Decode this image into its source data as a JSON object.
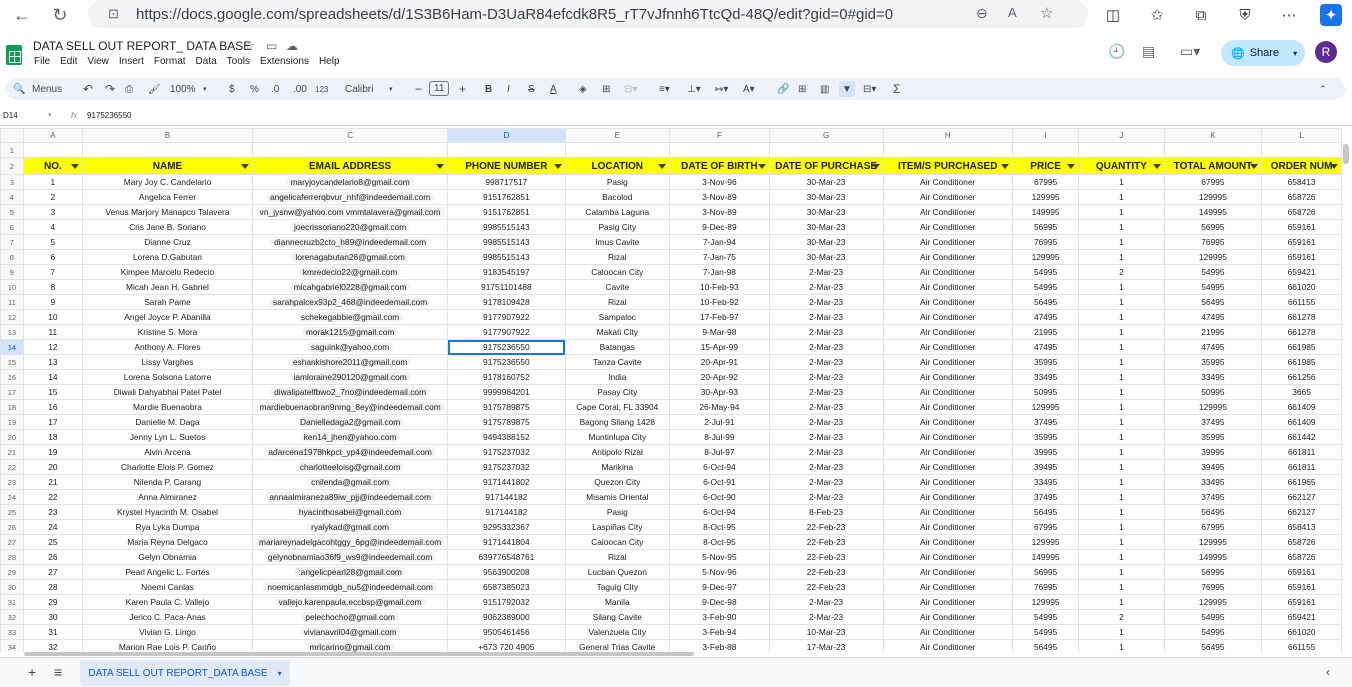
{
  "browser": {
    "url": "https://docs.google.com/spreadsheets/d/1S3B6Ham-D3UaR84efcdk8R5_rT7vJfnnh6TtcQd-48Q/edit?gid=0#gid=0",
    "zoom_glyph": "A͡"
  },
  "doc": {
    "title": "DATA SELL OUT REPORT_ DATA BASE",
    "menu": [
      "File",
      "Edit",
      "View",
      "Insert",
      "Format",
      "Data",
      "Tools",
      "Extensions",
      "Help"
    ],
    "share_label": "Share",
    "avatar_letter": "R"
  },
  "toolbar": {
    "menus_label": "Menus",
    "zoom": "100%",
    "currency": "$",
    "percent": "%",
    "dec_decrease": ".0",
    "dec_increase": ".00",
    "number_format": "123",
    "font": "Calibri",
    "font_size": "11",
    "bold": "B",
    "italic": "I",
    "strike": "S",
    "text_color": "A",
    "sigma": "Σ"
  },
  "formula": {
    "cell_ref": "D14",
    "fx": "fx",
    "value": "9175236550"
  },
  "columns": [
    "A",
    "B",
    "C",
    "D",
    "E",
    "F",
    "G",
    "H",
    "I",
    "J",
    "K",
    "L"
  ],
  "headers": [
    "NO.",
    "NAME",
    "EMAIL ADDRESS",
    "PHONE NUMBER",
    "LOCATION",
    "DATE OF BIRTH",
    "DATE OF PURCHASE",
    "ITEM/S PURCHASED",
    "PRICE",
    "QUANTITY",
    "TOTAL AMOUNT",
    "ORDER NUM"
  ],
  "rows": [
    [
      "1",
      "Mary Joy C. Candelario",
      "maryjoycandelario8@gmail.com",
      "998717517",
      "Pasig",
      "3-Nov-96",
      "30-Mar-23",
      "Air Conditioner",
      "67995",
      "1",
      "67995",
      "658413"
    ],
    [
      "2",
      "Angelica Ferrer",
      "angelicaferrerqbvur_nhf@indeedemail.com",
      "9151762851",
      "Bacolod",
      "3-Nov-89",
      "30-Mar-23",
      "Air Conditioner",
      "129995",
      "1",
      "129995",
      "658726"
    ],
    [
      "3",
      "Venus Marjory Manapco Talavera",
      "vn_jysnw@yahoo.com vmmtalavera@gmail.com",
      "9151762851",
      "Calamba Laguna",
      "3-Nov-89",
      "30-Mar-23",
      "Air Conditioner",
      "149995",
      "1",
      "149995",
      "658726"
    ],
    [
      "4",
      "Cris Jane B. Soriano",
      "joecrissoriano220@gmail.com",
      "9985515143",
      "Pasig City",
      "9-Dec-89",
      "30-Mar-23",
      "Air Conditioner",
      "56995",
      "1",
      "56995",
      "659161"
    ],
    [
      "5",
      "Dianne Cruz",
      "diannecruzb2cto_h89@indeedemail.com",
      "9985515143",
      "Imus Cavite",
      "7-Jan-94",
      "30-Mar-23",
      "Air Conditioner",
      "76995",
      "1",
      "76995",
      "659161"
    ],
    [
      "6",
      "Lorena D.Gabutan",
      "lorenagabutan26@gmail.com",
      "9985515143",
      "Rizal",
      "7-Jan-75",
      "30-Mar-23",
      "Air Conditioner",
      "129995",
      "1",
      "129995",
      "659161"
    ],
    [
      "7",
      "Kimpee Marcelo Redecio",
      "kmredecio22@gmail.com",
      "9183545197",
      "Caloocan City",
      "7-Jan-98",
      "2-Mar-23",
      "Air Conditioner",
      "54995",
      "2",
      "54995",
      "659421"
    ],
    [
      "8",
      "Micah Jean H. Gabriel",
      "micahgabriel0228@gmail.com",
      "91751101488",
      "Cavite",
      "10-Feb-93",
      "2-Mar-23",
      "Air Conditioner",
      "54995",
      "1",
      "54995",
      "661020"
    ],
    [
      "9",
      "Sarah Pame",
      "sarahpalcex93p2_468@indeedemail.com",
      "9178109428",
      "Rizal",
      "10-Feb-92",
      "2-Mar-23",
      "Air Conditioner",
      "56495",
      "1",
      "56495",
      "661155"
    ],
    [
      "10",
      "Angel Joyce P. Abanilla",
      "schekegabbie@gmail.com",
      "9177907922",
      "Sampaloc",
      "17-Feb-97",
      "2-Mar-23",
      "Air Conditioner",
      "47495",
      "1",
      "47495",
      "661278"
    ],
    [
      "11",
      "Kristine S. Mora",
      "morak1215@gmail.com",
      "9177907922",
      "Makati City",
      "9-Mar-98",
      "2-Mar-23",
      "Air Conditioner",
      "21995",
      "1",
      "21995",
      "661278"
    ],
    [
      "12",
      "Anthony A. Flores",
      "saguink@yahoo.com",
      "9175236550",
      "Batangas",
      "15-Apr-99",
      "2-Mar-23",
      "Air Conditioner",
      "47495",
      "1",
      "47495",
      "661985"
    ],
    [
      "13",
      "Lissy Varghes",
      "eshankishore2011@gmail.com",
      "9175236550",
      "Tanza Cavite",
      "20-Apr-91",
      "2-Mar-23",
      "Air Conditioner",
      "35995",
      "1",
      "35995",
      "661985"
    ],
    [
      "14",
      "Lorena Solsona Latorre",
      "iamloraine290120@gmail.com",
      "9178160752",
      "India",
      "20-Apr-92",
      "2-Mar-23",
      "Air Conditioner",
      "33495",
      "1",
      "33495",
      "661256"
    ],
    [
      "15",
      "Diwali Dahyabhai Patel Patel",
      "diwalipatelfbwo2_7no@indeedemail.com",
      "9999984201",
      "Pasay City",
      "30-Apr-93",
      "2-Mar-23",
      "Air Conditioner",
      "50995",
      "1",
      "50995",
      "3665"
    ],
    [
      "16",
      "Mardie Buenaobra",
      "mardiebuenaobran9nmg_8ey@indeedemail.com",
      "9175789875",
      "Cape Coral, FL 33904",
      "26-May-94",
      "2-Mar-23",
      "Air Conditioner",
      "129995",
      "1",
      "129995",
      "661409"
    ],
    [
      "17",
      "Danielle M. Daga",
      "Danielledaga2@gmail.com",
      "9175789875",
      "Bagong Silang 1428",
      "2-Jul-91",
      "2-Mar-23",
      "Air Conditioner",
      "37495",
      "1",
      "37495",
      "661409"
    ],
    [
      "18",
      "Jenny Lyn L. Suetos",
      "ken14_jhen@yahoo.com",
      "9494388152",
      "Muntinlupa City",
      "8-Jul-99",
      "2-Mar-23",
      "Air Conditioner",
      "35995",
      "1",
      "35995",
      "661442"
    ],
    [
      "19",
      "Alvin Arcena",
      "adarcena1978hkpct_yp4@indeedemail.com",
      "9175237032",
      "Antipolo Rizal",
      "8-Jul-97",
      "2-Mar-23",
      "Air Conditioner",
      "39995",
      "1",
      "39995",
      "661811"
    ],
    [
      "20",
      "Charlotte Elois P. Gomez",
      "charlotteeloisg@gmail.com",
      "9175237032",
      "Marikina",
      "6-Oct-94",
      "2-Mar-23",
      "Air Conditioner",
      "39495",
      "1",
      "39495",
      "661811"
    ],
    [
      "21",
      "Nilenda P. Carang",
      "cnilenda@gmail.com",
      "9171441802",
      "Quezon City",
      "6-Oct-91",
      "2-Mar-23",
      "Air Conditioner",
      "33495",
      "1",
      "33495",
      "661965"
    ],
    [
      "22",
      "Anna Almiranez",
      "annaalmiraneza89iw_pjj@indeedemail.com",
      "917144182",
      "Misamis Oriental",
      "6-Oct-90",
      "2-Mar-23",
      "Air Conditioner",
      "37495",
      "1",
      "37495",
      "662127"
    ],
    [
      "23",
      "Krystel Hyacinth M. Osabel",
      "hyacinthosabel@gmail.com",
      "917144182",
      "Pasig",
      "6-Oct-94",
      "8-Feb-23",
      "Air Conditioner",
      "56495",
      "1",
      "56495",
      "662127"
    ],
    [
      "24",
      "Rya Lyka Dumpa",
      "ryalykad@gmail.com",
      "9295332367",
      "Laspiñas City",
      "8-Oct-95",
      "22-Feb-23",
      "Air Conditioner",
      "67995",
      "1",
      "67995",
      "658413"
    ],
    [
      "25",
      "Maria Reyna Delgaco",
      "mariareynadelgacohtggy_6pg@indeedemail.com",
      "9171441804",
      "Caloocan City",
      "8-Oct-95",
      "22-Feb-23",
      "Air Conditioner",
      "129995",
      "1",
      "129995",
      "658726"
    ],
    [
      "26",
      "Gelyn Obnamia",
      "gelynobnamiao36f9_ws9@indeedemail.com",
      "639776548761",
      "Rizal",
      "5-Nov-95",
      "22-Feb-23",
      "Air Conditioner",
      "149995",
      "1",
      "149995",
      "658726"
    ],
    [
      "27",
      "Pearl Angelic L. Fortes",
      ":angelicpearl28@gmail.com",
      "9563900208",
      "Lucban Quezon",
      "5-Nov-96",
      "22-Feb-23",
      "Air Conditioner",
      "56995",
      "1",
      "56995",
      "659161"
    ],
    [
      "28",
      "Noemi Canlas",
      "noemicanlasmmdgb_nu5@indeedemail.com",
      "6587385023",
      "Taguig City",
      "9-Dec-97",
      "22-Feb-23",
      "Air Conditioner",
      "76995",
      "1",
      "76995",
      "659161"
    ],
    [
      "29",
      "Karen Paula C. Vallejo",
      "vallejo.karenpaula.eccbsp@gmail.com",
      "9151792032",
      "Manila",
      "9-Dec-98",
      "2-Mar-23",
      "Air Conditioner",
      "129995",
      "1",
      "129995",
      "659161"
    ],
    [
      "30",
      "Jerico C. Paca-Anas",
      "pelechocho@gmail.com",
      "9062389000",
      "Silang Cavite",
      "3-Feb-90",
      "2-Mar-23",
      "Air Conditioner",
      "54995",
      "2",
      "54995",
      "659421"
    ],
    [
      "31",
      "Vivian G. Lingo",
      "vivianavril04@gmail.com",
      "9505461456",
      "Valenzuela City",
      "3-Feb-94",
      "10-Mar-23",
      "Air Conditioner",
      "54995",
      "1",
      "54995",
      "661020"
    ],
    [
      "32",
      "Marion Rae Lois P. Cariño",
      "mrlcarino@gmail.com",
      "+673 720 4905",
      "General Trias Cavite",
      "3-Feb-88",
      "17-Mar-23",
      "Air Conditioner",
      "56495",
      "1",
      "56495",
      "661155"
    ]
  ],
  "row_numbers": [
    "1",
    "2",
    "3",
    "4",
    "5",
    "6",
    "7",
    "8",
    "9",
    "10",
    "11",
    "12",
    "13",
    "14",
    "15",
    "16",
    "17",
    "18",
    "19",
    "20",
    "21",
    "22",
    "23",
    "24",
    "25",
    "26",
    "27",
    "28",
    "29",
    "30",
    "31",
    "32",
    "33",
    "34"
  ],
  "sheet": {
    "add": "+",
    "list": "≡",
    "tab_label": "DATA SELL OUT REPORT_DATA BASE"
  }
}
